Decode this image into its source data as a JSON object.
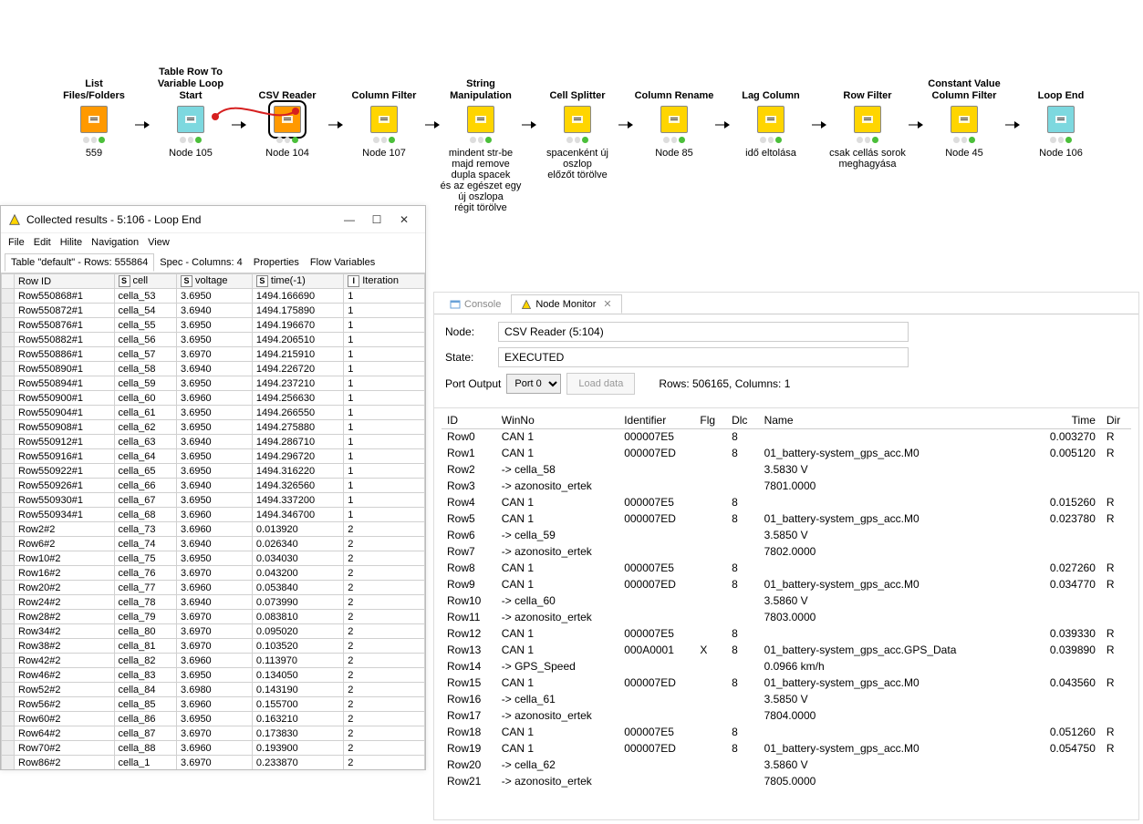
{
  "workflow": {
    "nodes": [
      {
        "title": "List Files/Folders",
        "footer": "559",
        "color": "orange",
        "selected": false
      },
      {
        "title": "Table Row To\nVariable Loop Start",
        "footer": "Node 105",
        "color": "cyan",
        "selected": false
      },
      {
        "title": "CSV Reader",
        "footer": "Node 104",
        "color": "orange",
        "selected": true
      },
      {
        "title": "Column Filter",
        "footer": "Node 107",
        "color": "yellow",
        "selected": false
      },
      {
        "title": "String Manipulation",
        "footer": "mindent str-be\nmajd remove dupla spacek\nés az egészet egy új oszlopa\nrégit törölve",
        "color": "yellow",
        "selected": false
      },
      {
        "title": "Cell Splitter",
        "footer": "spacenként új oszlop\nelőzőt törölve",
        "color": "yellow",
        "selected": false
      },
      {
        "title": "Column Rename",
        "footer": "Node 85",
        "color": "yellow",
        "selected": false
      },
      {
        "title": "Lag Column",
        "footer": "idő eltolása",
        "color": "yellow",
        "selected": false
      },
      {
        "title": "Row Filter",
        "footer": "csak cellás sorok\nmeghagyása",
        "color": "yellow",
        "selected": false
      },
      {
        "title": "Constant Value\nColumn Filter",
        "footer": "Node 45",
        "color": "yellow",
        "selected": false
      },
      {
        "title": "Loop End",
        "footer": "Node 106",
        "color": "cyan",
        "selected": false
      }
    ]
  },
  "resultsWindow": {
    "title": "Collected results - 5:106 - Loop End",
    "menu": [
      "File",
      "Edit",
      "Hilite",
      "Navigation",
      "View"
    ],
    "rowInfo": "Table \"default\" - Rows: 555864",
    "tabs": [
      "Spec - Columns: 4",
      "Properties",
      "Flow Variables"
    ],
    "columns": [
      {
        "h": "Row ID",
        "t": ""
      },
      {
        "h": "cell",
        "t": "S"
      },
      {
        "h": "voltage",
        "t": "S"
      },
      {
        "h": "time(-1)",
        "t": "S"
      },
      {
        "h": "Iteration",
        "t": "I"
      }
    ],
    "rows": [
      [
        "Row550868#1",
        "cella_53",
        "3.6950",
        "1494.166690",
        "1"
      ],
      [
        "Row550872#1",
        "cella_54",
        "3.6940",
        "1494.175890",
        "1"
      ],
      [
        "Row550876#1",
        "cella_55",
        "3.6950",
        "1494.196670",
        "1"
      ],
      [
        "Row550882#1",
        "cella_56",
        "3.6950",
        "1494.206510",
        "1"
      ],
      [
        "Row550886#1",
        "cella_57",
        "3.6970",
        "1494.215910",
        "1"
      ],
      [
        "Row550890#1",
        "cella_58",
        "3.6940",
        "1494.226720",
        "1"
      ],
      [
        "Row550894#1",
        "cella_59",
        "3.6950",
        "1494.237210",
        "1"
      ],
      [
        "Row550900#1",
        "cella_60",
        "3.6960",
        "1494.256630",
        "1"
      ],
      [
        "Row550904#1",
        "cella_61",
        "3.6950",
        "1494.266550",
        "1"
      ],
      [
        "Row550908#1",
        "cella_62",
        "3.6950",
        "1494.275880",
        "1"
      ],
      [
        "Row550912#1",
        "cella_63",
        "3.6940",
        "1494.286710",
        "1"
      ],
      [
        "Row550916#1",
        "cella_64",
        "3.6950",
        "1494.296720",
        "1"
      ],
      [
        "Row550922#1",
        "cella_65",
        "3.6950",
        "1494.316220",
        "1"
      ],
      [
        "Row550926#1",
        "cella_66",
        "3.6940",
        "1494.326560",
        "1"
      ],
      [
        "Row550930#1",
        "cella_67",
        "3.6950",
        "1494.337200",
        "1"
      ],
      [
        "Row550934#1",
        "cella_68",
        "3.6960",
        "1494.346700",
        "1"
      ],
      [
        "Row2#2",
        "cella_73",
        "3.6960",
        "0.013920",
        "2"
      ],
      [
        "Row6#2",
        "cella_74",
        "3.6940",
        "0.026340",
        "2"
      ],
      [
        "Row10#2",
        "cella_75",
        "3.6950",
        "0.034030",
        "2"
      ],
      [
        "Row16#2",
        "cella_76",
        "3.6970",
        "0.043200",
        "2"
      ],
      [
        "Row20#2",
        "cella_77",
        "3.6960",
        "0.053840",
        "2"
      ],
      [
        "Row24#2",
        "cella_78",
        "3.6940",
        "0.073990",
        "2"
      ],
      [
        "Row28#2",
        "cella_79",
        "3.6970",
        "0.083810",
        "2"
      ],
      [
        "Row34#2",
        "cella_80",
        "3.6970",
        "0.095020",
        "2"
      ],
      [
        "Row38#2",
        "cella_81",
        "3.6970",
        "0.103520",
        "2"
      ],
      [
        "Row42#2",
        "cella_82",
        "3.6960",
        "0.113970",
        "2"
      ],
      [
        "Row46#2",
        "cella_83",
        "3.6950",
        "0.134050",
        "2"
      ],
      [
        "Row52#2",
        "cella_84",
        "3.6980",
        "0.143190",
        "2"
      ],
      [
        "Row56#2",
        "cella_85",
        "3.6960",
        "0.155700",
        "2"
      ],
      [
        "Row60#2",
        "cella_86",
        "3.6950",
        "0.163210",
        "2"
      ],
      [
        "Row64#2",
        "cella_87",
        "3.6970",
        "0.173830",
        "2"
      ],
      [
        "Row70#2",
        "cella_88",
        "3.6960",
        "0.193900",
        "2"
      ],
      [
        "Row86#2",
        "cella_1",
        "3.6970",
        "0.233870",
        "2"
      ]
    ]
  },
  "monitor": {
    "tabs": {
      "console": "Console",
      "node_monitor": "Node Monitor"
    },
    "node_label": "Node:",
    "node_value": "CSV Reader  (5:104)",
    "state_label": "State:",
    "state_value": "EXECUTED",
    "port_label": "Port Output",
    "port_value": "Port 0",
    "load_button": "Load data",
    "rows_info": "Rows: 506165, Columns: 1",
    "columns": [
      "ID",
      "WinNo",
      "Identifier",
      "Flg",
      "Dlc",
      "Name",
      "Time",
      "Dir"
    ],
    "rows": [
      [
        "Row0",
        "CAN 1",
        "000007E5",
        "",
        "8",
        "",
        "0.003270",
        "R"
      ],
      [
        "Row1",
        "CAN 1",
        "000007ED",
        "",
        "8",
        "01_battery-system_gps_acc.M0",
        "0.005120",
        "R"
      ],
      [
        "Row2",
        "-> cella_58",
        "",
        "",
        "",
        "3.5830 V",
        "",
        ""
      ],
      [
        "Row3",
        "-> azonosito_ertek",
        "",
        "",
        "",
        "7801.0000",
        "",
        ""
      ],
      [
        "Row4",
        "CAN 1",
        "000007E5",
        "",
        "8",
        "",
        "0.015260",
        "R"
      ],
      [
        "Row5",
        "CAN 1",
        "000007ED",
        "",
        "8",
        "01_battery-system_gps_acc.M0",
        "0.023780",
        "R"
      ],
      [
        "Row6",
        "-> cella_59",
        "",
        "",
        "",
        "3.5850 V",
        "",
        ""
      ],
      [
        "Row7",
        "-> azonosito_ertek",
        "",
        "",
        "",
        "7802.0000",
        "",
        ""
      ],
      [
        "Row8",
        "CAN 1",
        "000007E5",
        "",
        "8",
        "",
        "0.027260",
        "R"
      ],
      [
        "Row9",
        "CAN 1",
        "000007ED",
        "",
        "8",
        "01_battery-system_gps_acc.M0",
        "0.034770",
        "R"
      ],
      [
        "Row10",
        "-> cella_60",
        "",
        "",
        "",
        "3.5860 V",
        "",
        ""
      ],
      [
        "Row11",
        "-> azonosito_ertek",
        "",
        "",
        "",
        "7803.0000",
        "",
        ""
      ],
      [
        "Row12",
        "CAN 1",
        "000007E5",
        "",
        "8",
        "",
        "0.039330",
        "R"
      ],
      [
        "Row13",
        "CAN 1",
        "000A0001",
        "X",
        "8",
        "01_battery-system_gps_acc.GPS_Data",
        "0.039890",
        "R"
      ],
      [
        "Row14",
        "-> GPS_Speed",
        "",
        "",
        "",
        "0.0966 km/h",
        "",
        ""
      ],
      [
        "Row15",
        "CAN 1",
        "000007ED",
        "",
        "8",
        "01_battery-system_gps_acc.M0",
        "0.043560",
        "R"
      ],
      [
        "Row16",
        "-> cella_61",
        "",
        "",
        "",
        "3.5850 V",
        "",
        ""
      ],
      [
        "Row17",
        "-> azonosito_ertek",
        "",
        "",
        "",
        "7804.0000",
        "",
        ""
      ],
      [
        "Row18",
        "CAN 1",
        "000007E5",
        "",
        "8",
        "",
        "0.051260",
        "R"
      ],
      [
        "Row19",
        "CAN 1",
        "000007ED",
        "",
        "8",
        "01_battery-system_gps_acc.M0",
        "0.054750",
        "R"
      ],
      [
        "Row20",
        "-> cella_62",
        "",
        "",
        "",
        "3.5860 V",
        "",
        ""
      ],
      [
        "Row21",
        "-> azonosito_ertek",
        "",
        "",
        "",
        "7805.0000",
        "",
        ""
      ]
    ]
  }
}
